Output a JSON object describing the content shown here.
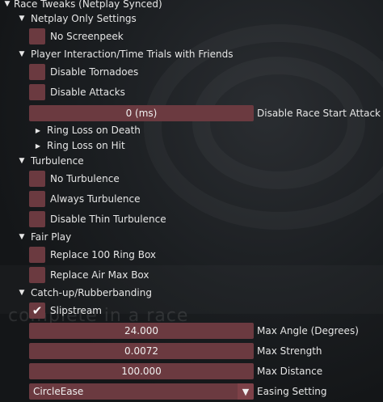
{
  "header": {
    "title": "Race Tweaks (Netplay Synced)"
  },
  "netplay": {
    "title": "Netplay Only Settings",
    "items": [
      {
        "label": "No Screenpeek",
        "checked": false
      }
    ]
  },
  "interaction": {
    "title": "Player Interaction/Time Trials with Friends",
    "items": [
      {
        "label": "Disable Tornadoes",
        "checked": false
      },
      {
        "label": "Disable Attacks",
        "checked": false
      }
    ],
    "start_attack": {
      "value": "0 (ms)",
      "label": "Disable Race Start Attack"
    },
    "collapsed": [
      "Ring Loss on Death",
      "Ring Loss on Hit"
    ]
  },
  "turbulence": {
    "title": "Turbulence",
    "items": [
      {
        "label": "No Turbulence",
        "checked": false
      },
      {
        "label": "Always Turbulence",
        "checked": false
      },
      {
        "label": "Disable Thin Turbulence",
        "checked": false
      }
    ]
  },
  "fair_play": {
    "title": "Fair Play",
    "items": [
      {
        "label": "Replace 100 Ring Box",
        "checked": false
      },
      {
        "label": "Replace Air Max Box",
        "checked": false
      }
    ]
  },
  "catchup": {
    "title": "Catch-up/Rubberbanding",
    "slipstream": {
      "label": "Slipstream",
      "checked": true
    },
    "fields": [
      {
        "value": "24.000",
        "label": "Max Angle (Degrees)"
      },
      {
        "value": "0.0072",
        "label": "Max Strength"
      },
      {
        "value": "100.000",
        "label": "Max Distance"
      }
    ],
    "easing": {
      "value": "CircleEase",
      "label": "Easing Setting"
    }
  },
  "background_text": "complete in a race",
  "icons": {
    "expanded": "▼",
    "collapsed": "▶",
    "check": "✔"
  },
  "colors": {
    "frame": "#6b3a40",
    "background": "#141618",
    "text": "#e6e6e6"
  }
}
